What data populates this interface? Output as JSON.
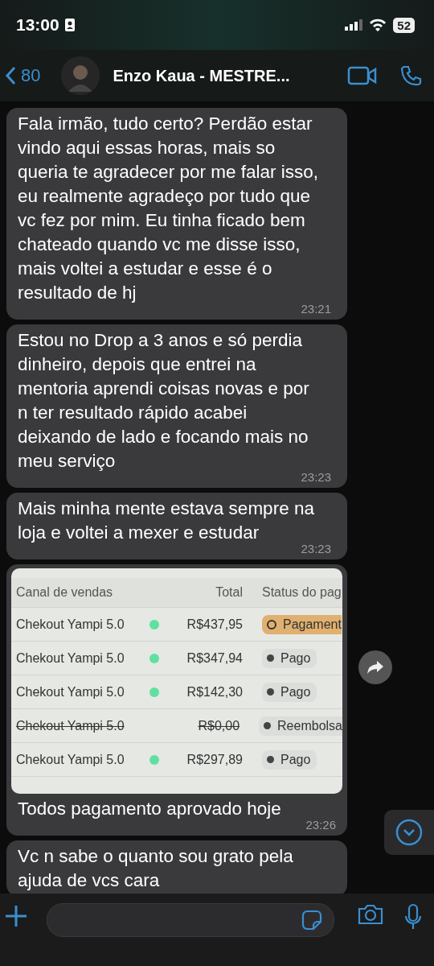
{
  "status_bar": {
    "time": "13:00",
    "battery": "52"
  },
  "header": {
    "back_count": "80",
    "contact_name": "Enzo Kaua - MESTRE..."
  },
  "messages": [
    {
      "kind": "text",
      "text": "Fala irmão, tudo certo? Perdão estar vindo aqui essas horas, mais so queria te agradecer por me falar isso, eu realmente agradeço por tudo que vc fez por mim. Eu tinha ficado bem chateado quando vc me disse isso, mais voltei a estudar e esse é o resultado de hj",
      "time": "23:21"
    },
    {
      "kind": "text",
      "text": "Estou no Drop a 3 anos e só perdia dinheiro, depois que entrei na mentoria aprendi coisas novas e por n ter resultado rápido acabei deixando de lado e focando mais no meu serviço",
      "time": "23:23"
    },
    {
      "kind": "text",
      "text": "Mais minha mente estava sempre na loja e voltei a mexer e estudar",
      "time": "23:23"
    },
    {
      "kind": "table",
      "columns": [
        "Canal de vendas",
        "Total",
        "Status do pag"
      ],
      "rows": [
        {
          "channel": "Chekout Yampi 5.0",
          "dot": true,
          "total": "R$437,95",
          "status": "Pagament",
          "kind": "pending",
          "struck": false
        },
        {
          "channel": "Chekout Yampi 5.0",
          "dot": true,
          "total": "R$347,94",
          "status": "Pago",
          "kind": "paid",
          "struck": false
        },
        {
          "channel": "Chekout Yampi 5.0",
          "dot": true,
          "total": "R$142,30",
          "status": "Pago",
          "kind": "paid",
          "struck": false
        },
        {
          "channel": "Chekout Yampi 5.0",
          "dot": false,
          "total": "R$0,00",
          "status": "Reembolsa",
          "kind": "refunded",
          "struck": true
        },
        {
          "channel": "Chekout Yampi 5.0",
          "dot": true,
          "total": "R$297,89",
          "status": "Pago",
          "kind": "paid",
          "struck": false
        }
      ],
      "caption": "Todos pagamento aprovado hoje",
      "time": "23:26"
    },
    {
      "kind": "text",
      "text": "Vc n sabe o quanto sou grato pela ajuda de vcs cara"
    }
  ]
}
